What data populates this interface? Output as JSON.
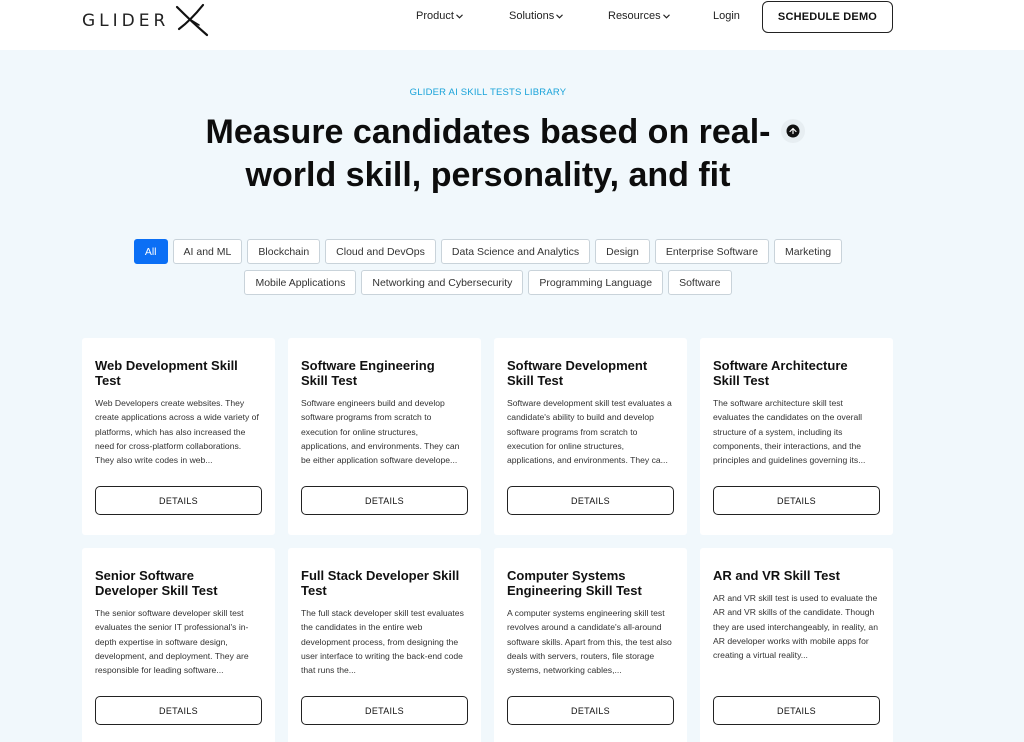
{
  "header": {
    "logo_text": "GLIDER",
    "nav": [
      {
        "label": "Product"
      },
      {
        "label": "Solutions"
      },
      {
        "label": "Resources"
      },
      {
        "label": "Login"
      }
    ],
    "cta_label": "SCHEDULE DEMO"
  },
  "hero": {
    "eyebrow": "GLIDER AI SKILL TESTS LIBRARY",
    "title": "Measure candidates based on real-world skill, personality, and fit"
  },
  "filters": {
    "active": "All",
    "items": [
      "All",
      "AI and ML",
      "Blockchain",
      "Cloud and DevOps",
      "Data Science and Analytics",
      "Design",
      "Enterprise Software",
      "Marketing",
      "Mobile Applications",
      "Networking and Cybersecurity",
      "Programming Language",
      "Software"
    ]
  },
  "cards": [
    {
      "title": "Web Development Skill Test",
      "desc": "Web Developers create websites. They create applications across a wide variety of platforms, which has also increased the need for cross-platform collaborations. They also write codes in web...",
      "button": "DETAILS"
    },
    {
      "title": "Software Engineering Skill Test",
      "desc": "Software engineers build and develop software programs from scratch to execution for online structures, applications, and environments. They can be either application software develope...",
      "button": "DETAILS"
    },
    {
      "title": "Software Development Skill Test",
      "desc": "Software development skill test evaluates a candidate's ability to build and develop software programs from scratch to execution for online structures, applications, and environments. They ca...",
      "button": "DETAILS"
    },
    {
      "title": "Software Architecture Skill Test",
      "desc": "The software architecture skill test evaluates the candidates on the overall structure of a system, including its components, their interactions, and the principles and guidelines governing its...",
      "button": "DETAILS"
    },
    {
      "title": "Senior Software Developer Skill Test",
      "desc": "The senior software developer skill test evaluates the senior IT professional's in-depth expertise in software design, development, and deployment. They are responsible for leading software...",
      "button": "DETAILS"
    },
    {
      "title": "Full Stack Developer Skill Test",
      "desc": "The full stack developer skill test evaluates the candidates in the entire web development process, from designing the user interface to writing the back-end code that runs the...",
      "button": "DETAILS"
    },
    {
      "title": "Computer Systems Engineering Skill Test",
      "desc": "A computer systems engineering skill test revolves around a candidate's all-around software skills. Apart from this, the test also deals with servers, routers, file storage systems, networking cables,...",
      "button": "DETAILS"
    },
    {
      "title": "AR and VR Skill Test",
      "desc": "AR and VR skill test is used to evaluate the AR and VR skills of the candidate. Though they are used interchangeably, in reality, an AR developer works with mobile apps for creating a virtual reality...",
      "button": "DETAILS"
    }
  ],
  "colors": {
    "accent": "#0b6ff5",
    "eyebrow": "#1aa3d9",
    "background": "#f1f8fc"
  }
}
